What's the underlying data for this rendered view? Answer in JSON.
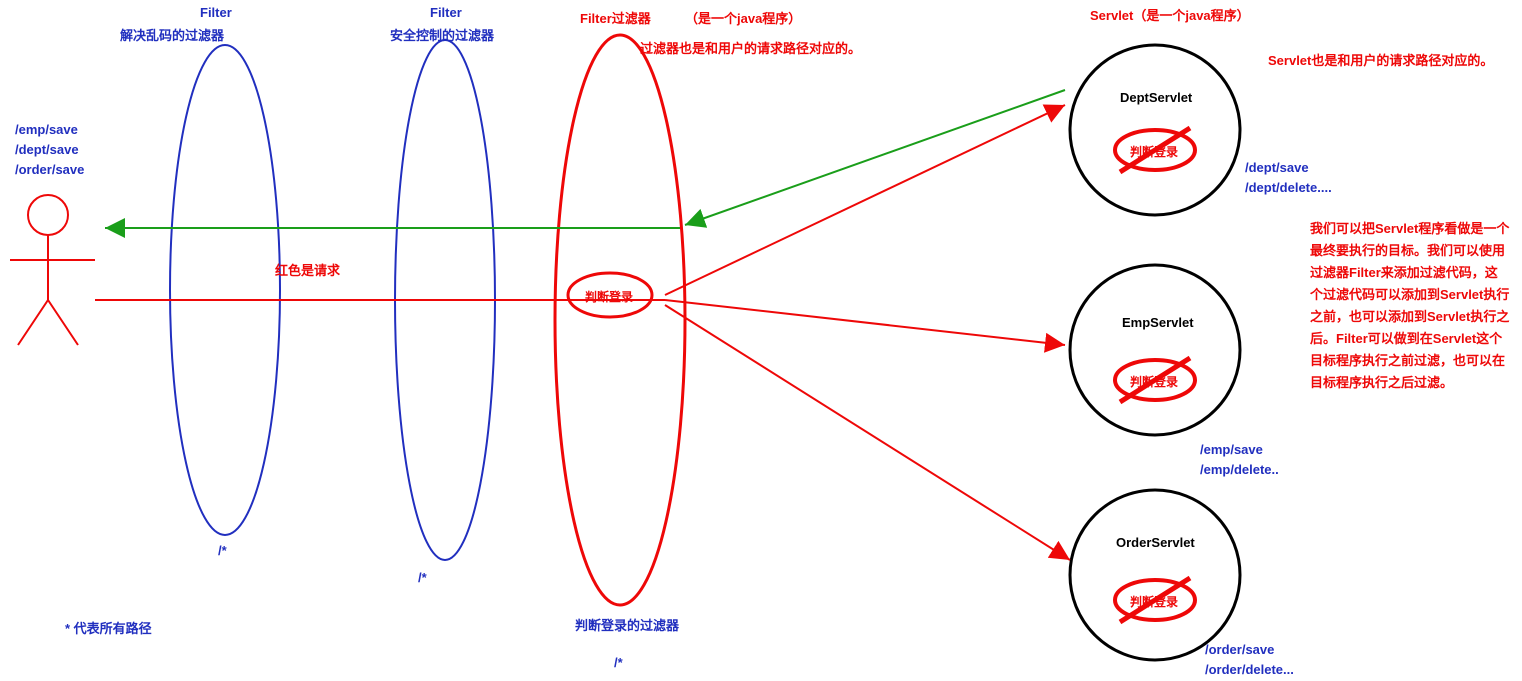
{
  "filters": {
    "encoding": {
      "title": "Filter",
      "desc": "解决乱码的过滤器",
      "pattern": "/*"
    },
    "security": {
      "title": "Filter",
      "desc": "安全控制的过滤器",
      "pattern": "/*"
    },
    "login": {
      "title": "Filter过滤器",
      "note": "（是一个java程序）",
      "desc2": "过滤器也是和用户的请求路径对应的。",
      "inner": "判断登录",
      "bottom_desc": "判断登录的过滤器",
      "pattern": "/*"
    }
  },
  "user": {
    "paths": "/emp/save\n/dept/save\n/order/save",
    "request_note": "红色是请求",
    "wildcard_note": "* 代表所有路径"
  },
  "servlets_header": "Servlet（是一个java程序）",
  "servlets_note": "Servlet也是和用户的请求路径对应的。",
  "servlets": {
    "dept": {
      "name": "DeptServlet",
      "inner": "判断登录",
      "paths": "/dept/save\n/dept/delete...."
    },
    "emp": {
      "name": "EmpServlet",
      "inner": "判断登录",
      "paths": "/emp/save\n/emp/delete.."
    },
    "order": {
      "name": "OrderServlet",
      "inner": "判断登录",
      "paths": "/order/save\n/order/delete..."
    }
  },
  "explanation": "我们可以把Servlet程序看做是一个最终要执行的目标。我们可以使用过滤器Filter来添加过滤代码，这个过滤代码可以添加到Servlet执行之前，也可以添加到Servlet执行之后。Filter可以做到在Servlet这个目标程序执行之前过滤，也可以在目标程序执行之后过滤。"
}
